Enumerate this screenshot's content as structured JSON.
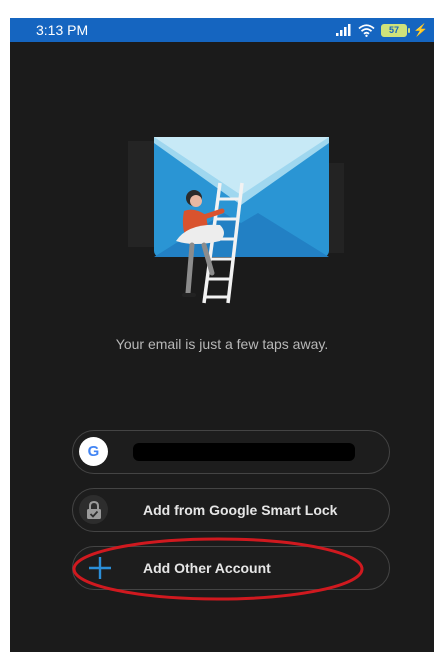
{
  "status_bar": {
    "time": "3:13 PM",
    "battery_level": "57",
    "icons": [
      "signal-icon",
      "wifi-icon",
      "battery-icon",
      "charging-icon"
    ]
  },
  "onboarding": {
    "tagline": "Your email is just a few taps away."
  },
  "accounts": {
    "google_letter": "G",
    "smart_lock_label": "Add from Google Smart Lock",
    "other_account_label": "Add Other Account"
  },
  "colors": {
    "status_bar": "#1565c0",
    "background": "#1b1b1b",
    "accent": "#2b8fd9",
    "annotation": "#d0191f"
  }
}
